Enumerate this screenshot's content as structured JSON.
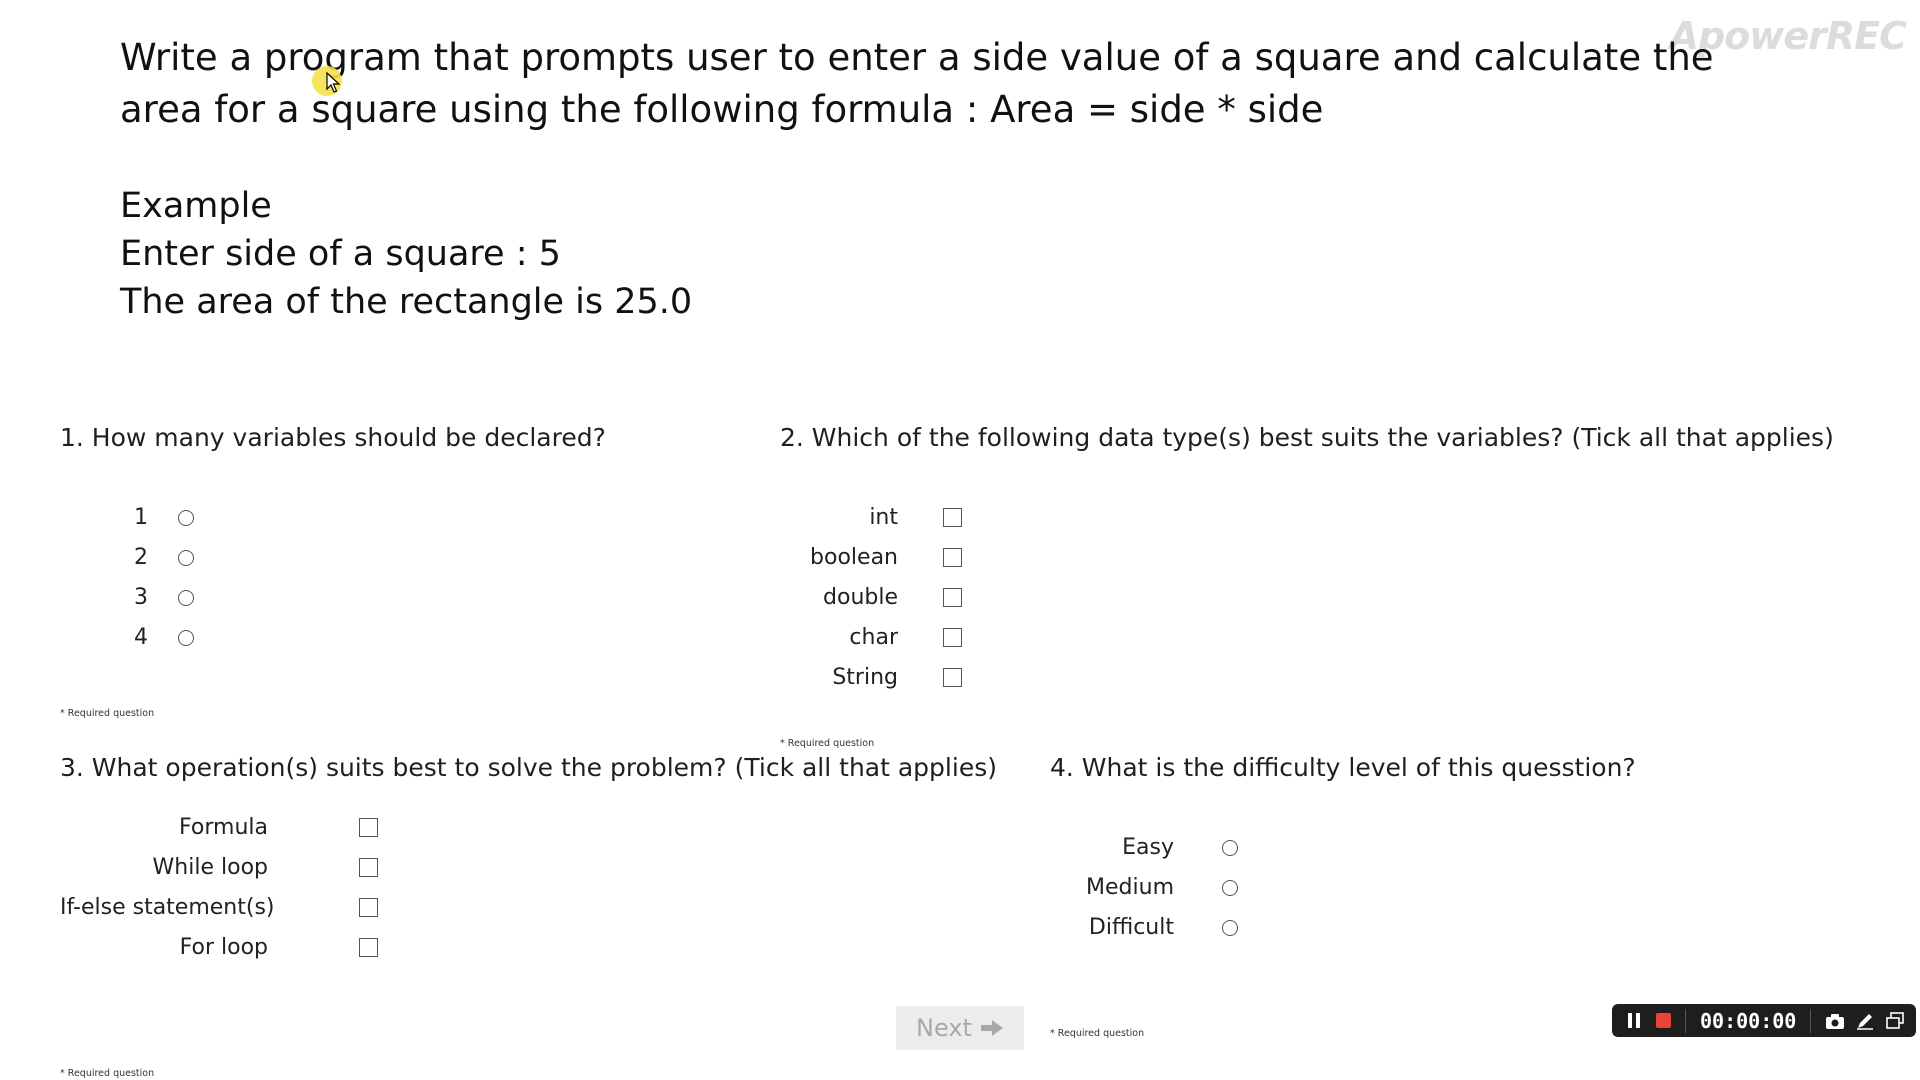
{
  "question": {
    "prompt": "Write a program that prompts user to enter a side value of a square and calculate the area for a square using the following formula : Area = side * side",
    "example_lines": [
      "Example",
      "Enter side of a square : 5",
      "The area of the rectangle is 25.0"
    ]
  },
  "q1": {
    "title": "1.  How many variables should be declared?",
    "options": [
      "1",
      "2",
      "3",
      "4"
    ],
    "required": "* Required question"
  },
  "q2": {
    "title": "2.  Which of the following data type(s) best suits the variables? (Tick all that applies)",
    "options": [
      "int",
      "boolean",
      "double",
      "char",
      "String"
    ],
    "required": "* Required question"
  },
  "q3": {
    "title": "3. What operation(s) suits best to solve the problem? (Tick all that applies)",
    "options": [
      "Formula",
      "While loop",
      "If-else statement(s)",
      "For loop"
    ],
    "required": "* Required question"
  },
  "q4": {
    "title": "4.  What is the difficulty level of this quesstion?",
    "options": [
      "Easy",
      "Medium",
      "Difficult"
    ],
    "required": "* Required question"
  },
  "navigation": {
    "next_label": "Next"
  },
  "recorder": {
    "watermark": "ApowerREC",
    "timer": "00:00:00",
    "icons": [
      "pause-icon",
      "stop-icon",
      "camera-icon",
      "pen-icon",
      "window-icon"
    ]
  },
  "colors": {
    "next_bg": "#ececec",
    "next_text": "#a8a8a8",
    "stop_red": "#e8443a",
    "cursor_highlight": "#f5e24a"
  }
}
